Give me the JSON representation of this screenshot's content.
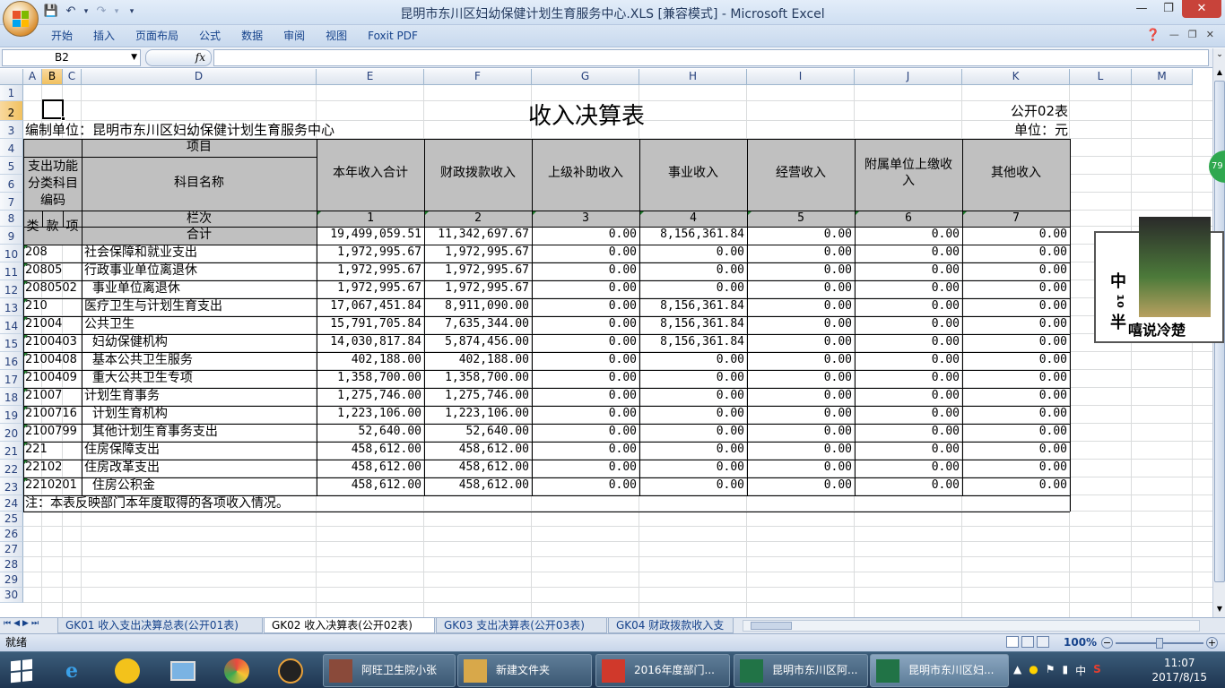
{
  "window": {
    "title": "昆明市东川区妇幼保健计划生育服务中心.XLS  [兼容模式] - Microsoft Excel"
  },
  "ribbon_tabs": [
    "开始",
    "插入",
    "页面布局",
    "公式",
    "数据",
    "审阅",
    "视图",
    "Foxit PDF"
  ],
  "namebox": "B2",
  "fx_label": "fx",
  "col_headers": [
    "A",
    "B",
    "C",
    "D",
    "E",
    "F",
    "G",
    "H",
    "I",
    "J",
    "K",
    "L",
    "M"
  ],
  "row_numbers": [
    "1",
    "2",
    "3",
    "4",
    "5",
    "6",
    "7",
    "8",
    "9",
    "10",
    "11",
    "12",
    "13",
    "14",
    "15",
    "16",
    "17",
    "18",
    "19",
    "20",
    "21",
    "22",
    "23",
    "24",
    "25",
    "26",
    "27",
    "28",
    "29",
    "30"
  ],
  "sheet": {
    "title": "收入决算表",
    "form_no": "公开02表",
    "unit_label": "编制单位：昆明市东川区妇幼保健计划生育服务中心",
    "currency": "单位：元",
    "hdr_item": "项目",
    "hdr_code": "支出功能分类科目编码",
    "hdr_name": "科目名称",
    "hdr_lanci": "栏次",
    "hdr_total": "合计",
    "hdr_lei": "类",
    "hdr_kuan": "款",
    "hdr_xiang": "项",
    "columns": [
      {
        "name": "本年收入合计",
        "no": "1"
      },
      {
        "name": "财政拨款收入",
        "no": "2"
      },
      {
        "name": "上级补助收入",
        "no": "3"
      },
      {
        "name": "事业收入",
        "no": "4"
      },
      {
        "name": "经营收入",
        "no": "5"
      },
      {
        "name": "附属单位上缴收入",
        "no": "6"
      },
      {
        "name": "其他收入",
        "no": "7"
      }
    ],
    "total_row": [
      "19,499,059.51",
      "11,342,697.67",
      "0.00",
      "8,156,361.84",
      "0.00",
      "0.00",
      "0.00"
    ],
    "rows": [
      {
        "code": "208",
        "name": "社会保障和就业支出",
        "v": [
          "1,972,995.67",
          "1,972,995.67",
          "0.00",
          "0.00",
          "0.00",
          "0.00",
          "0.00"
        ]
      },
      {
        "code": "20805",
        "name": "行政事业单位离退休",
        "v": [
          "1,972,995.67",
          "1,972,995.67",
          "0.00",
          "0.00",
          "0.00",
          "0.00",
          "0.00"
        ]
      },
      {
        "code": "2080502",
        "name": "  事业单位离退休",
        "v": [
          "1,972,995.67",
          "1,972,995.67",
          "0.00",
          "0.00",
          "0.00",
          "0.00",
          "0.00"
        ]
      },
      {
        "code": "210",
        "name": "医疗卫生与计划生育支出",
        "v": [
          "17,067,451.84",
          "8,911,090.00",
          "0.00",
          "8,156,361.84",
          "0.00",
          "0.00",
          "0.00"
        ]
      },
      {
        "code": "21004",
        "name": "公共卫生",
        "v": [
          "15,791,705.84",
          "7,635,344.00",
          "0.00",
          "8,156,361.84",
          "0.00",
          "0.00",
          "0.00"
        ]
      },
      {
        "code": "2100403",
        "name": "  妇幼保健机构",
        "v": [
          "14,030,817.84",
          "5,874,456.00",
          "0.00",
          "8,156,361.84",
          "0.00",
          "0.00",
          "0.00"
        ]
      },
      {
        "code": "2100408",
        "name": "  基本公共卫生服务",
        "v": [
          "402,188.00",
          "402,188.00",
          "0.00",
          "0.00",
          "0.00",
          "0.00",
          "0.00"
        ]
      },
      {
        "code": "2100409",
        "name": "  重大公共卫生专项",
        "v": [
          "1,358,700.00",
          "1,358,700.00",
          "0.00",
          "0.00",
          "0.00",
          "0.00",
          "0.00"
        ]
      },
      {
        "code": "21007",
        "name": "计划生育事务",
        "v": [
          "1,275,746.00",
          "1,275,746.00",
          "0.00",
          "0.00",
          "0.00",
          "0.00",
          "0.00"
        ]
      },
      {
        "code": "2100716",
        "name": "  计划生育机构",
        "v": [
          "1,223,106.00",
          "1,223,106.00",
          "0.00",
          "0.00",
          "0.00",
          "0.00",
          "0.00"
        ]
      },
      {
        "code": "2100799",
        "name": "  其他计划生育事务支出",
        "v": [
          "52,640.00",
          "52,640.00",
          "0.00",
          "0.00",
          "0.00",
          "0.00",
          "0.00"
        ]
      },
      {
        "code": "221",
        "name": "住房保障支出",
        "v": [
          "458,612.00",
          "458,612.00",
          "0.00",
          "0.00",
          "0.00",
          "0.00",
          "0.00"
        ]
      },
      {
        "code": "22102",
        "name": "住房改革支出",
        "v": [
          "458,612.00",
          "458,612.00",
          "0.00",
          "0.00",
          "0.00",
          "0.00",
          "0.00"
        ]
      },
      {
        "code": "2210201",
        "name": "  住房公积金",
        "v": [
          "458,612.00",
          "458,612.00",
          "0.00",
          "0.00",
          "0.00",
          "0.00",
          "0.00"
        ]
      }
    ],
    "note": "注：本表反映部门本年度取得的各项收入情况。"
  },
  "sheet_tabs": [
    "GK01 收入支出决算总表(公开01表)",
    "GK02 收入决算表(公开02表)",
    "GK03 支出决算表(公开03表)",
    "GK04 财政拨款收入支"
  ],
  "status": {
    "ready": "就绪",
    "zoom": "100%"
  },
  "taskbar": {
    "tasks": [
      "阿旺卫生院小张",
      "新建文件夹",
      "2016年度部门...",
      "昆明市东川区阿...",
      "昆明市东川区妇..."
    ],
    "time": "11:07",
    "date": "2017/8/15",
    "ime": "中"
  },
  "sticker": {
    "text": "中 ¹⁰ 半",
    "caption": "嘻说冷楚"
  },
  "badge": "79"
}
